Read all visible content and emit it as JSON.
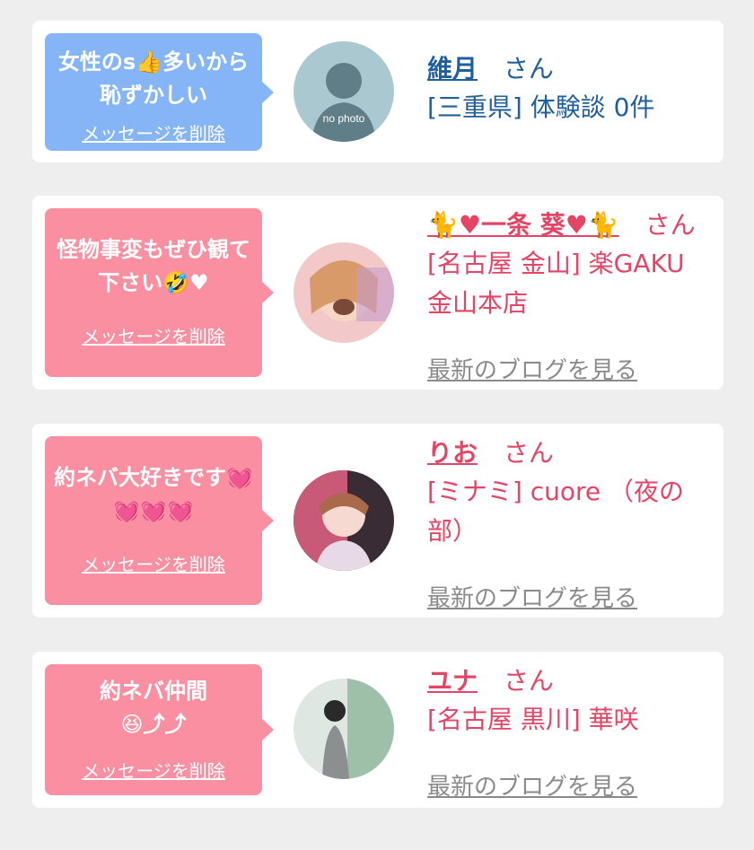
{
  "entries": [
    {
      "message": "女性のs👍多いから恥ずかしい",
      "delete_label": "メッセージを削除",
      "name": "維月",
      "honorific": "さん",
      "location": "[三重県] 体験談 0件",
      "avatar_text": "no photo",
      "theme_color": "#85b4f7"
    },
    {
      "message": "怪物事変もぜひ観て下さい🤣♥",
      "delete_label": "メッセージを削除",
      "name": "🐈♥一条 葵♥🐈",
      "honorific": "さん",
      "location": "[名古屋 金山] 楽GAKU金山本店",
      "blog_link": "最新のブログを見る",
      "theme_color": "#f98fa1"
    },
    {
      "message": "約ネバ大好きです💓💓💓💓",
      "delete_label": "メッセージを削除",
      "name": "りお",
      "honorific": "さん",
      "location": "[ミナミ] cuore （夜の部）",
      "blog_link": "最新のブログを見る",
      "theme_color": "#f98fa1"
    },
    {
      "message": "約ネバ仲間😆⤴⤴",
      "delete_label": "メッセージを削除",
      "name": "ユナ",
      "honorific": "さん",
      "location": "[名古屋 黒川] 華咲",
      "blog_link": "最新のブログを見る",
      "theme_color": "#f98fa1"
    }
  ],
  "colors": {
    "page_bg": "#eeeeee",
    "card_bg": "#ffffff",
    "name_blue": "#1f5f9e",
    "name_pink": "#e44565",
    "link_gray": "#8a8a8a"
  }
}
